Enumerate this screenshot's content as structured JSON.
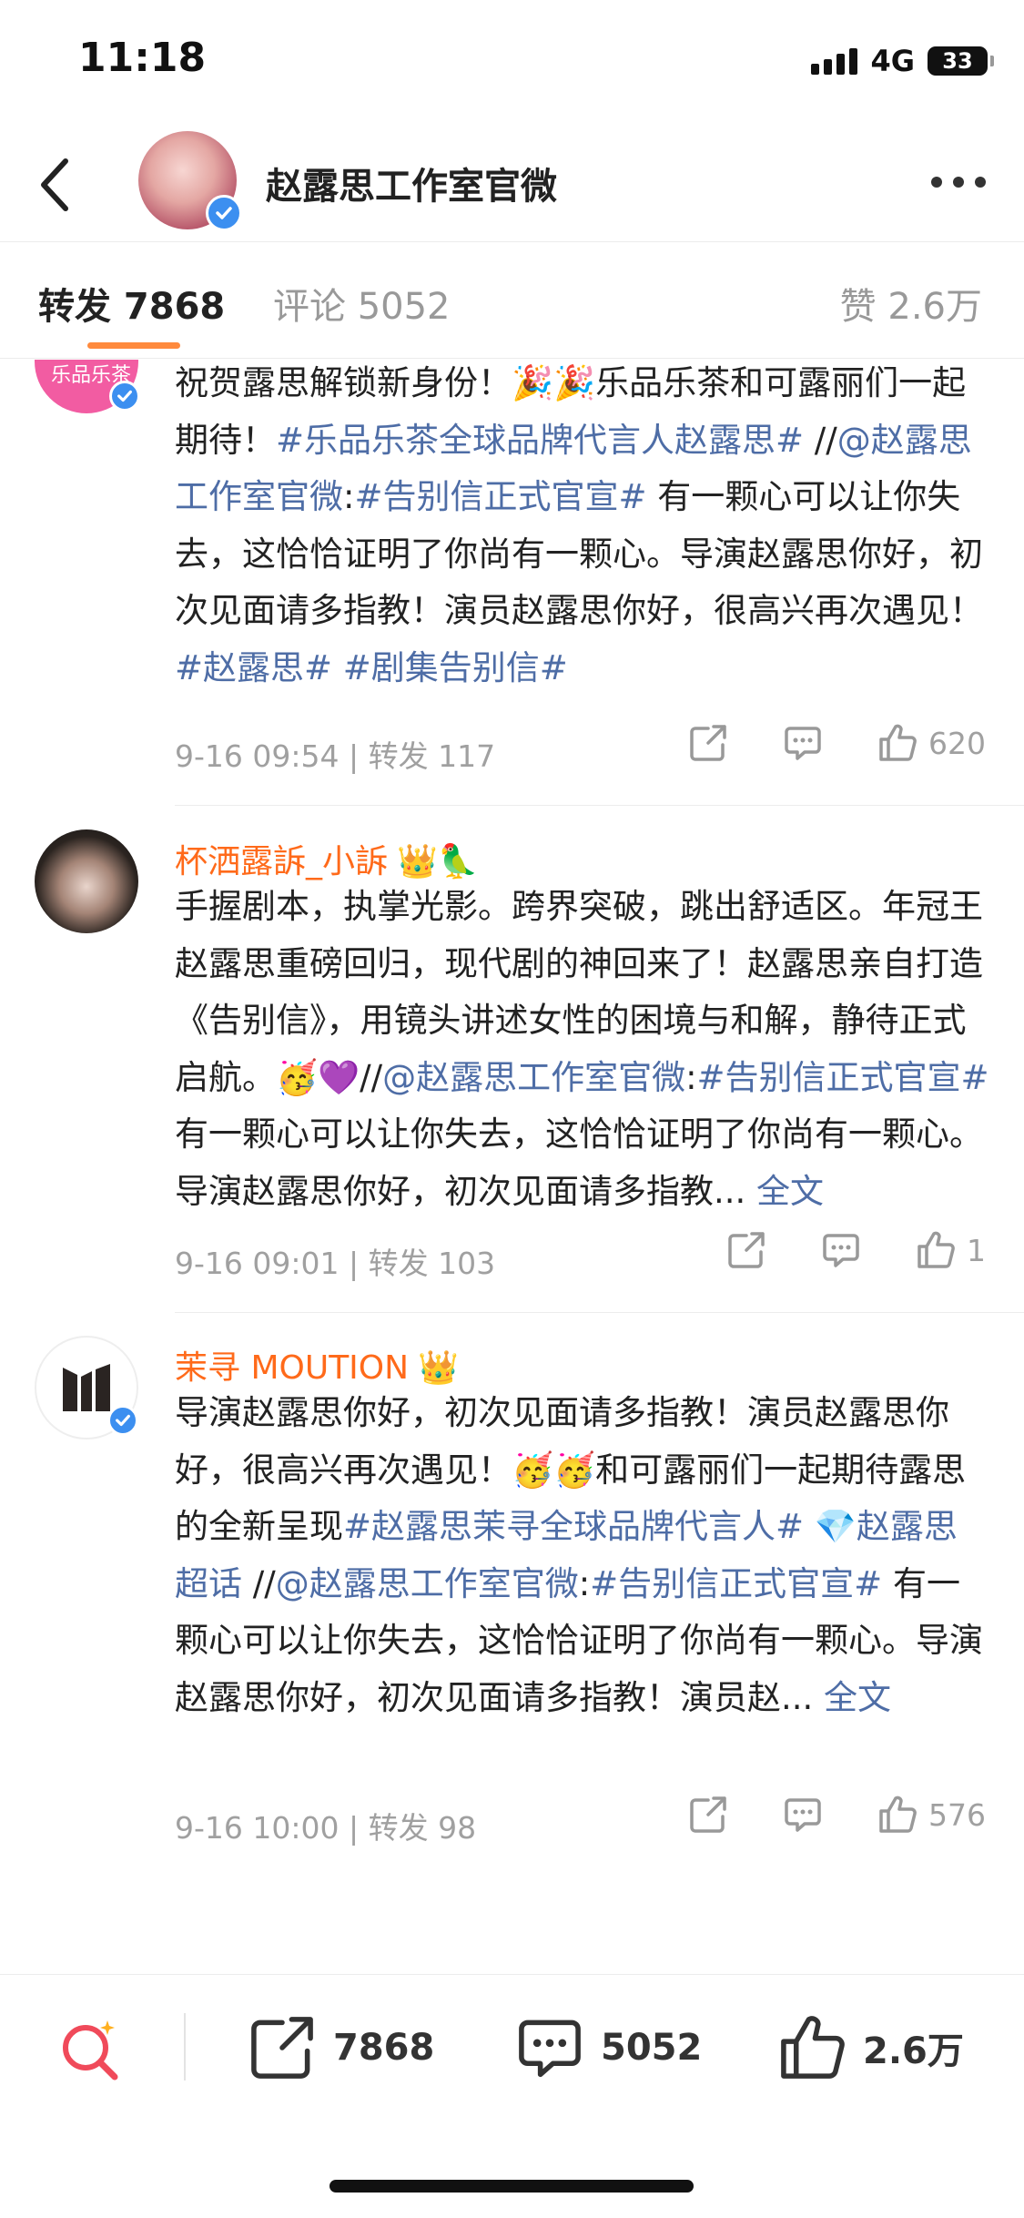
{
  "status": {
    "time": "11:18",
    "network": "4G",
    "battery": "33"
  },
  "header": {
    "title": "赵露思工作室官微"
  },
  "tabs": {
    "repost": "转发 7868",
    "comment": "评论 5052",
    "like": "赞 2.6万"
  },
  "posts": [
    {
      "avatar_text": "乐品乐茶",
      "parts": [
        {
          "t": "祝贺露思解锁新身份！🎉🎉乐品乐茶和可露丽们一起期待！"
        },
        {
          "t": "#乐品乐茶全球品牌代言人赵露思#",
          "link": true
        },
        {
          "t": " //"
        },
        {
          "t": "@赵露思工作室官微",
          "link": true
        },
        {
          "t": ":"
        },
        {
          "t": "#告别信正式官宣#",
          "link": true
        },
        {
          "t": " 有一颗心可以让你失去，这恰恰证明了你尚有一颗心。导演赵露思你好，初次见面请多指教！演员赵露思你好，很高兴再次遇见！"
        },
        {
          "t": "#赵露思#",
          "link": true
        },
        {
          "t": " "
        },
        {
          "t": "#剧集告别信#",
          "link": true
        }
      ],
      "meta": "9-16 09:54 | 转发 117",
      "likes": "620"
    },
    {
      "username": "杯洒露訴_小訴",
      "username_icons": "👑🦜",
      "parts": [
        {
          "t": "手握剧本，执掌光影。跨界突破，跳出舒适区。年冠王赵露思重磅回归，现代剧的神回来了！赵露思亲自打造《告别信》，用镜头讲述女性的困境与和解，静待正式启航。🥳💜//"
        },
        {
          "t": "@赵露思工作室官微",
          "link": true
        },
        {
          "t": ":"
        },
        {
          "t": "#告别信正式官宣#",
          "link": true
        },
        {
          "t": " 有一颗心可以让你失去，这恰恰证明了你尚有一颗心。导演赵露思你好，初次见面请多指教... "
        },
        {
          "t": "全文",
          "link": true
        }
      ],
      "meta": "9-16 09:01 | 转发 103",
      "likes": "1"
    },
    {
      "username": "茉寻 MOUTION",
      "username_icons": "👑",
      "parts": [
        {
          "t": "导演赵露思你好，初次见面请多指教！演员赵露思你好，很高兴再次遇见！🥳🥳和可露丽们一起期待露思的全新呈现"
        },
        {
          "t": "#赵露思茉寻全球品牌代言人#",
          "link": true
        },
        {
          "t": " "
        },
        {
          "t": "💎赵露思超话",
          "link": true
        },
        {
          "t": " //"
        },
        {
          "t": "@赵露思工作室官微",
          "link": true
        },
        {
          "t": ":"
        },
        {
          "t": "#告别信正式官宣#",
          "link": true
        },
        {
          "t": " 有一颗心可以让你失去，这恰恰证明了你尚有一颗心。导演赵露思你好，初次见面请多指教！演员赵... "
        },
        {
          "t": "全文",
          "link": true
        }
      ],
      "meta": "9-16 10:00 | 转发 98",
      "likes": "576"
    }
  ],
  "bottom": {
    "repost": "7868",
    "comment": "5052",
    "like": "2.6万"
  },
  "colors": {
    "accent": "#ff8a3d",
    "username": "#ff6a1a",
    "link": "#4e6da6",
    "verified": "#3c8ff0"
  },
  "icons": [
    "back-arrow-icon",
    "more-dots-icon",
    "share-icon",
    "comment-icon",
    "thumbs-up-icon",
    "search-icon",
    "verified-icon"
  ]
}
